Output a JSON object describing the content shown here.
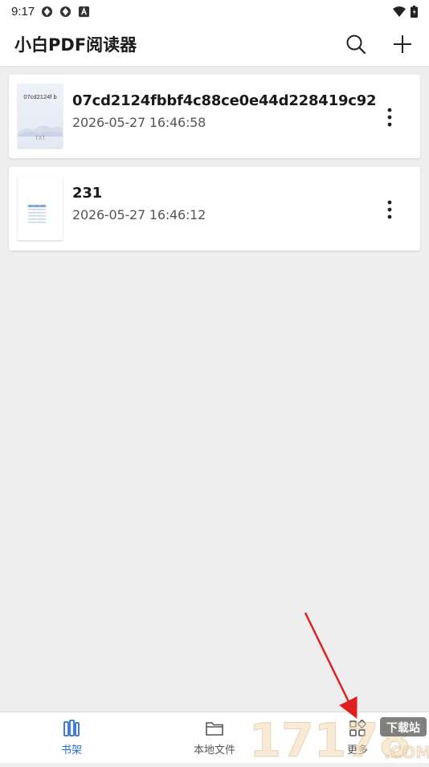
{
  "status_bar": {
    "time": "9:17"
  },
  "app_bar": {
    "title": "小白PDF阅读器"
  },
  "files": [
    {
      "name": "07cd2124fbbf4c88ce0e44d228419c92",
      "date": "2026-05-27 16:46:58",
      "thumb_title": "07cd2124f b",
      "thumb_tag": "TXT"
    },
    {
      "name": "231",
      "date": "2026-05-27 16:46:12"
    }
  ],
  "bottom_nav": {
    "items": [
      {
        "label": "书架",
        "icon": "bookshelf-icon",
        "active": true
      },
      {
        "label": "本地文件",
        "icon": "folder-icon",
        "active": false
      },
      {
        "label": "更多",
        "icon": "apps-icon",
        "active": false
      }
    ]
  },
  "watermark": {
    "text": "17178",
    "sub": "下载站",
    "domain": ".COM"
  },
  "colors": {
    "accent": "#2a6fd6",
    "annotation_arrow": "#e02020"
  }
}
